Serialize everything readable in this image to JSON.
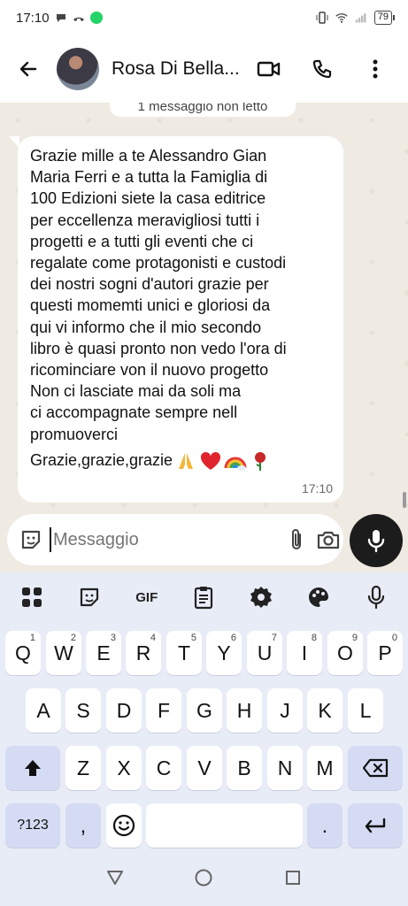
{
  "status_bar": {
    "time": "17:10",
    "battery": "79"
  },
  "header": {
    "contact_name": "Rosa Di Bella..."
  },
  "chat": {
    "unread_label": "1 messaggio non letto",
    "message": {
      "text": "Grazie mille a te Alessandro Gian\nMaria Ferri e a tutta la Famiglia di\n100 Edizioni siete la casa editrice\nper eccellenza meravigliosi tutti i\nprogetti e a tutti gli eventi che ci\nregalate come protagonisti e custodi\ndei nostri sogni d'autori grazie per\nquesti momemti unici e gloriosi da\nqui vi informo che il mio secondo\nlibro è quasi pronto non vedo l'ora di\nricominciare von il nuovo progetto\nNon ci lasciate mai da soli ma\nci accompagnate sempre nell\npromuoverci",
      "last_line": "Grazie,grazie,grazie",
      "emojis": [
        "folded-hands",
        "red-heart",
        "rainbow",
        "rose"
      ],
      "time": "17:10"
    }
  },
  "composer": {
    "placeholder": "Messaggio"
  },
  "keyboard": {
    "toolbar": [
      "apps-grid-icon",
      "sticker-icon",
      "GIF",
      "clipboard-icon",
      "settings-gear-icon",
      "palette-icon",
      "microphone-icon"
    ],
    "gif_label": "GIF",
    "row1": [
      {
        "k": "Q",
        "h": "1"
      },
      {
        "k": "W",
        "h": "2"
      },
      {
        "k": "E",
        "h": "3"
      },
      {
        "k": "R",
        "h": "4"
      },
      {
        "k": "T",
        "h": "5"
      },
      {
        "k": "Y",
        "h": "6"
      },
      {
        "k": "U",
        "h": "7"
      },
      {
        "k": "I",
        "h": "8"
      },
      {
        "k": "O",
        "h": "9"
      },
      {
        "k": "P",
        "h": "0"
      }
    ],
    "row2": [
      "A",
      "S",
      "D",
      "F",
      "G",
      "H",
      "J",
      "K",
      "L"
    ],
    "row3": [
      "Z",
      "X",
      "C",
      "V",
      "B",
      "N",
      "M"
    ],
    "symbols_label": "?123",
    "comma_label": ",",
    "period_label": "."
  },
  "colors": {
    "accent": "#25d366",
    "bubble": "#ffffff",
    "chat_bg": "#efeae2",
    "keyboard_bg": "#e8ecf7",
    "fn_key": "#d4dbf3"
  }
}
